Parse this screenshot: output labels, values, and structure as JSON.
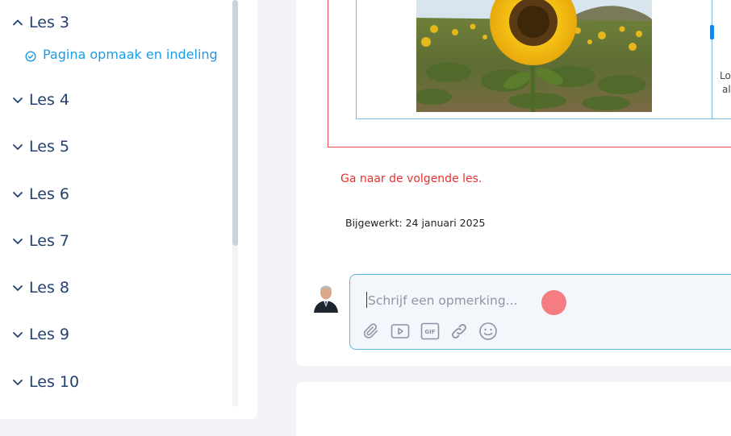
{
  "sidebar": {
    "expanded_lesson": {
      "label": "Les 3"
    },
    "sub_item": {
      "label": "Pagina opmaak en indeling",
      "status": "completed"
    },
    "lessons": [
      {
        "label": "Les 4"
      },
      {
        "label": "Les 5"
      },
      {
        "label": "Les 6"
      },
      {
        "label": "Les 7"
      },
      {
        "label": "Les 8"
      },
      {
        "label": "Les 9"
      },
      {
        "label": "Les 10"
      }
    ]
  },
  "content": {
    "side_text_line1": "Lo",
    "side_text_line2": "al",
    "image_alt": "sunflower field",
    "next_link": "Ga naar de volgende les.",
    "updated_label": "Bijgewerkt:",
    "updated_date": "24 januari 2025"
  },
  "comment": {
    "placeholder": "Schrijf een opmerking...",
    "value": "",
    "tools": [
      "attachment-icon",
      "video-icon",
      "gif-icon",
      "link-icon",
      "emoji-icon"
    ]
  },
  "colors": {
    "lesson_text": "#24406e",
    "sub_item_text": "#1a9be6",
    "next_link": "#e8302f",
    "input_border": "#5fb8ea",
    "frame_red": "#e8504f",
    "frame_blue": "#7ab8e8"
  }
}
